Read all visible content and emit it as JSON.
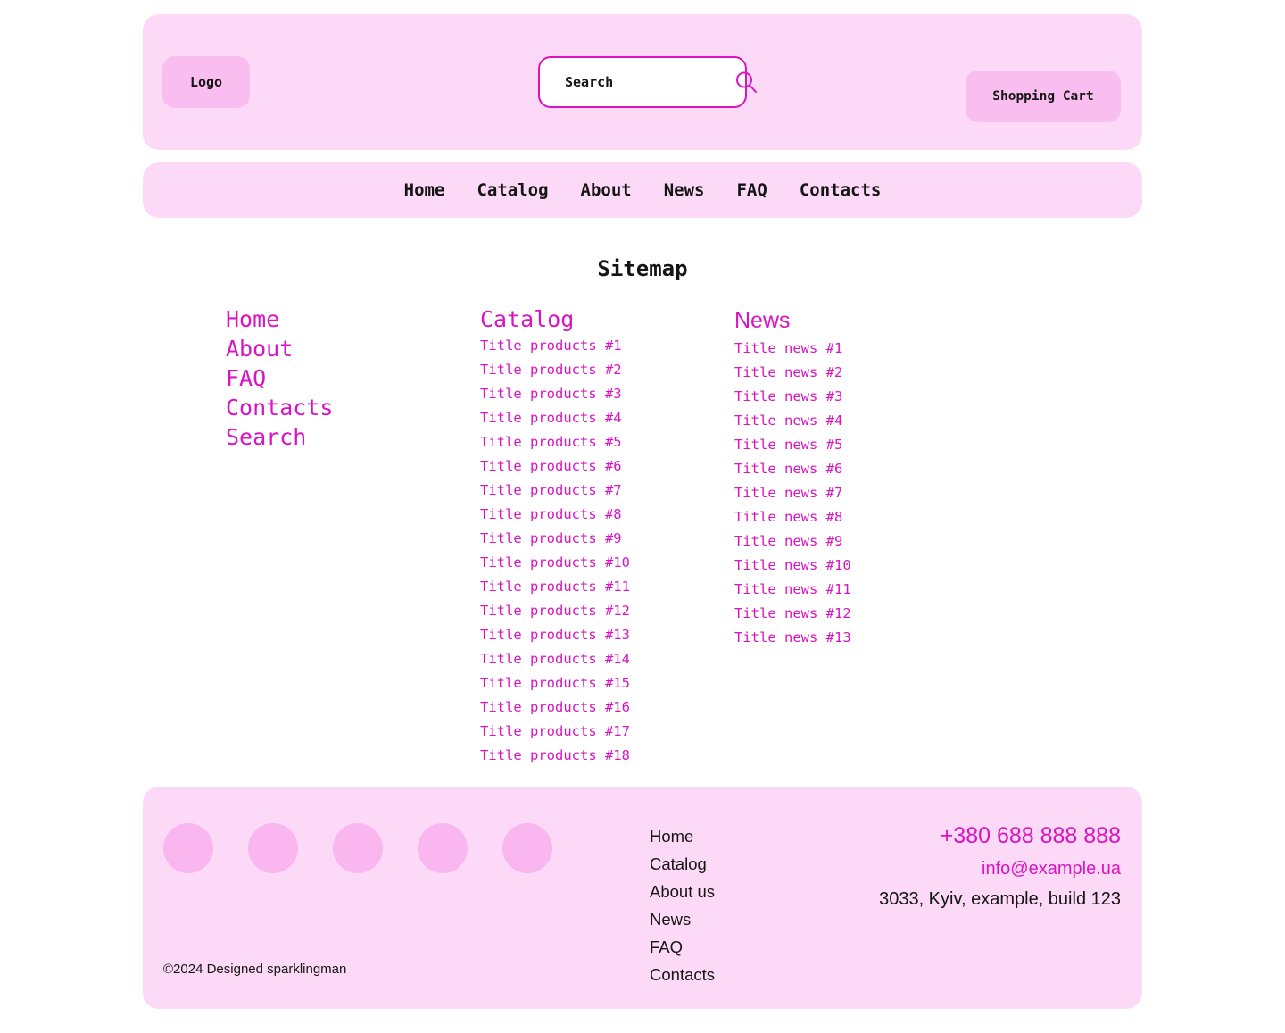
{
  "colors": {
    "page_bg": "#ffffff",
    "panel_bg": "#fcd9f6",
    "accent_pink": "#f9bdf0",
    "magenta": "#d915c2",
    "text_dark": "#151515"
  },
  "header": {
    "logo_label": "Logo",
    "search": {
      "placeholder": "Search",
      "value": "",
      "icon": "search-icon"
    },
    "cart_label": "Shopping Cart"
  },
  "nav": {
    "items": [
      {
        "label": "Home"
      },
      {
        "label": "Catalog"
      },
      {
        "label": "About"
      },
      {
        "label": "News"
      },
      {
        "label": "FAQ"
      },
      {
        "label": "Contacts"
      }
    ]
  },
  "sitemap": {
    "title": "Sitemap",
    "main_links": [
      {
        "label": "Home"
      },
      {
        "label": "About"
      },
      {
        "label": "FAQ"
      },
      {
        "label": "Contacts"
      },
      {
        "label": "Search"
      }
    ],
    "catalog": {
      "heading": "Catalog",
      "items": [
        {
          "label": "Title products #1"
        },
        {
          "label": "Title products #2"
        },
        {
          "label": "Title products #3"
        },
        {
          "label": "Title products #4"
        },
        {
          "label": "Title products #5"
        },
        {
          "label": "Title products #6"
        },
        {
          "label": "Title products #7"
        },
        {
          "label": "Title products #8"
        },
        {
          "label": "Title products #9"
        },
        {
          "label": "Title products #10"
        },
        {
          "label": "Title products #11"
        },
        {
          "label": "Title products #12"
        },
        {
          "label": "Title products #13"
        },
        {
          "label": "Title products #14"
        },
        {
          "label": "Title products #15"
        },
        {
          "label": "Title products #16"
        },
        {
          "label": "Title products #17"
        },
        {
          "label": "Title products #18"
        }
      ]
    },
    "news": {
      "heading": "News",
      "items": [
        {
          "label": "Title news #1"
        },
        {
          "label": "Title news #2"
        },
        {
          "label": "Title news #3"
        },
        {
          "label": "Title news #4"
        },
        {
          "label": "Title news #5"
        },
        {
          "label": "Title news #6"
        },
        {
          "label": "Title news #7"
        },
        {
          "label": "Title news #8"
        },
        {
          "label": "Title news #9"
        },
        {
          "label": "Title news #10"
        },
        {
          "label": "Title news #11"
        },
        {
          "label": "Title news #12"
        },
        {
          "label": "Title news #13"
        }
      ]
    }
  },
  "footer": {
    "socials": [
      {
        "name": "social-circle-1"
      },
      {
        "name": "social-circle-2"
      },
      {
        "name": "social-circle-3"
      },
      {
        "name": "social-circle-4"
      },
      {
        "name": "social-circle-5"
      }
    ],
    "copyright": "©2024 Designed sparklingman",
    "nav": [
      {
        "label": "Home"
      },
      {
        "label": "Catalog"
      },
      {
        "label": "About us"
      },
      {
        "label": "News"
      },
      {
        "label": "FAQ"
      },
      {
        "label": "Contacts"
      }
    ],
    "contacts": {
      "phone": "+380 688 888 888",
      "email": "info@example.ua",
      "address": "3033, Kyiv, example, build 123"
    }
  }
}
